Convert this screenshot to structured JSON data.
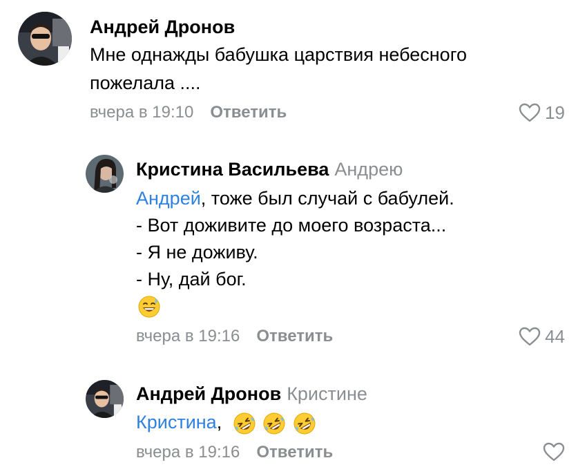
{
  "comments": [
    {
      "author": "Андрей Дронов",
      "reply_to": "",
      "lines": [
        "Мне однажды бабушка царствия небесного",
        "пожелала ...."
      ],
      "time": "вчера в 19:10",
      "reply_label": "Ответить",
      "likes": "19"
    },
    {
      "author": "Кристина Васильева",
      "reply_to": "Андрею",
      "mention": "Андрей",
      "first_line_rest": ", тоже был случай с бабулей.",
      "lines": [
        "- Вот доживите до моего возраста...",
        "- Я не доживу.",
        "- Ну, дай бог."
      ],
      "emoji": "sweat-smile-emoji",
      "time": "вчера в 19:16",
      "reply_label": "Ответить",
      "likes": "44"
    },
    {
      "author": "Андрей Дронов",
      "reply_to": "Кристине",
      "mention": "Кристина",
      "first_line_rest": ",",
      "emojis": [
        "rofl-emoji",
        "rofl-emoji",
        "rofl-emoji"
      ],
      "time": "вчера в 19:16",
      "reply_label": "Ответить",
      "likes": ""
    }
  ],
  "colors": {
    "mention": "#2d81e0",
    "secondary": "#8a8d91",
    "text": "#000000"
  },
  "icons": [
    "heart-outline-icon"
  ]
}
